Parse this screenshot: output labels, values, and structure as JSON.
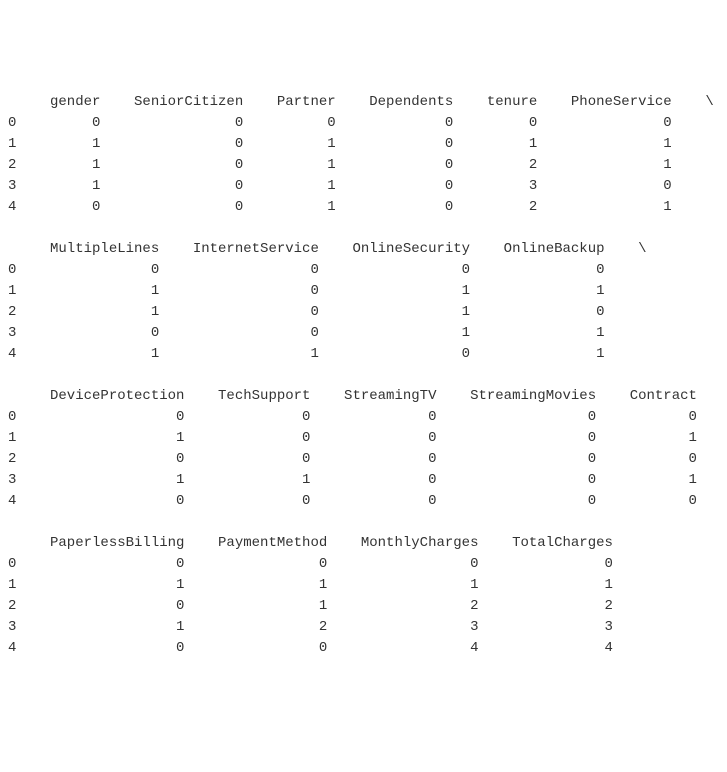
{
  "blocks": [
    {
      "headers": [
        "",
        "gender",
        "SeniorCitizen",
        "Partner",
        "Dependents",
        "tenure",
        "PhoneService",
        "\\"
      ],
      "rows": [
        [
          "0",
          "0",
          "0",
          "0",
          "0",
          "0",
          "0",
          ""
        ],
        [
          "1",
          "1",
          "0",
          "1",
          "0",
          "1",
          "1",
          ""
        ],
        [
          "2",
          "1",
          "0",
          "1",
          "0",
          "2",
          "1",
          ""
        ],
        [
          "3",
          "1",
          "0",
          "1",
          "0",
          "3",
          "0",
          ""
        ],
        [
          "4",
          "0",
          "0",
          "1",
          "0",
          "2",
          "1",
          ""
        ]
      ],
      "widths": [
        1,
        8,
        15,
        9,
        12,
        8,
        14,
        3
      ]
    },
    {
      "headers": [
        "",
        "MultipleLines",
        "InternetService",
        "OnlineSecurity",
        "OnlineBackup",
        "\\"
      ],
      "rows": [
        [
          "0",
          "0",
          "0",
          "0",
          "0",
          ""
        ],
        [
          "1",
          "1",
          "0",
          "1",
          "1",
          ""
        ],
        [
          "2",
          "1",
          "0",
          "1",
          "0",
          ""
        ],
        [
          "3",
          "0",
          "0",
          "1",
          "1",
          ""
        ],
        [
          "4",
          "1",
          "1",
          "0",
          "1",
          ""
        ]
      ],
      "widths": [
        1,
        15,
        17,
        16,
        14,
        3
      ]
    },
    {
      "headers": [
        "",
        "DeviceProtection",
        "TechSupport",
        "StreamingTV",
        "StreamingMovies",
        "Contract",
        "\\"
      ],
      "rows": [
        [
          "0",
          "0",
          "0",
          "0",
          "0",
          "0",
          ""
        ],
        [
          "1",
          "1",
          "0",
          "0",
          "0",
          "1",
          ""
        ],
        [
          "2",
          "0",
          "0",
          "0",
          "0",
          "0",
          ""
        ],
        [
          "3",
          "1",
          "1",
          "0",
          "0",
          "1",
          ""
        ],
        [
          "4",
          "0",
          "0",
          "0",
          "0",
          "0",
          ""
        ]
      ],
      "widths": [
        1,
        18,
        13,
        13,
        17,
        10,
        3
      ]
    },
    {
      "headers": [
        "",
        "PaperlessBilling",
        "PaymentMethod",
        "MonthlyCharges",
        "TotalCharges"
      ],
      "rows": [
        [
          "0",
          "0",
          "0",
          "0",
          "0"
        ],
        [
          "1",
          "1",
          "1",
          "1",
          "1"
        ],
        [
          "2",
          "0",
          "1",
          "2",
          "2"
        ],
        [
          "3",
          "1",
          "2",
          "3",
          "3"
        ],
        [
          "4",
          "0",
          "0",
          "4",
          "4"
        ]
      ],
      "widths": [
        1,
        18,
        15,
        16,
        14
      ]
    }
  ]
}
